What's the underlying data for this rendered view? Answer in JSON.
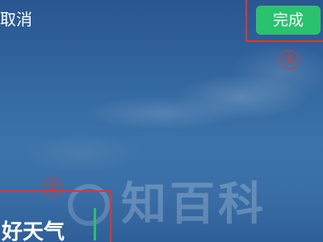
{
  "toolbar": {
    "cancel_label": "取消",
    "done_label": "完成"
  },
  "annotations": {
    "step_2": "②",
    "step_3": "③"
  },
  "editor": {
    "text": "好天气"
  },
  "watermark": {
    "text": "知百科"
  },
  "colors": {
    "accent": "#2bc26f",
    "highlight": "#e0352b"
  }
}
